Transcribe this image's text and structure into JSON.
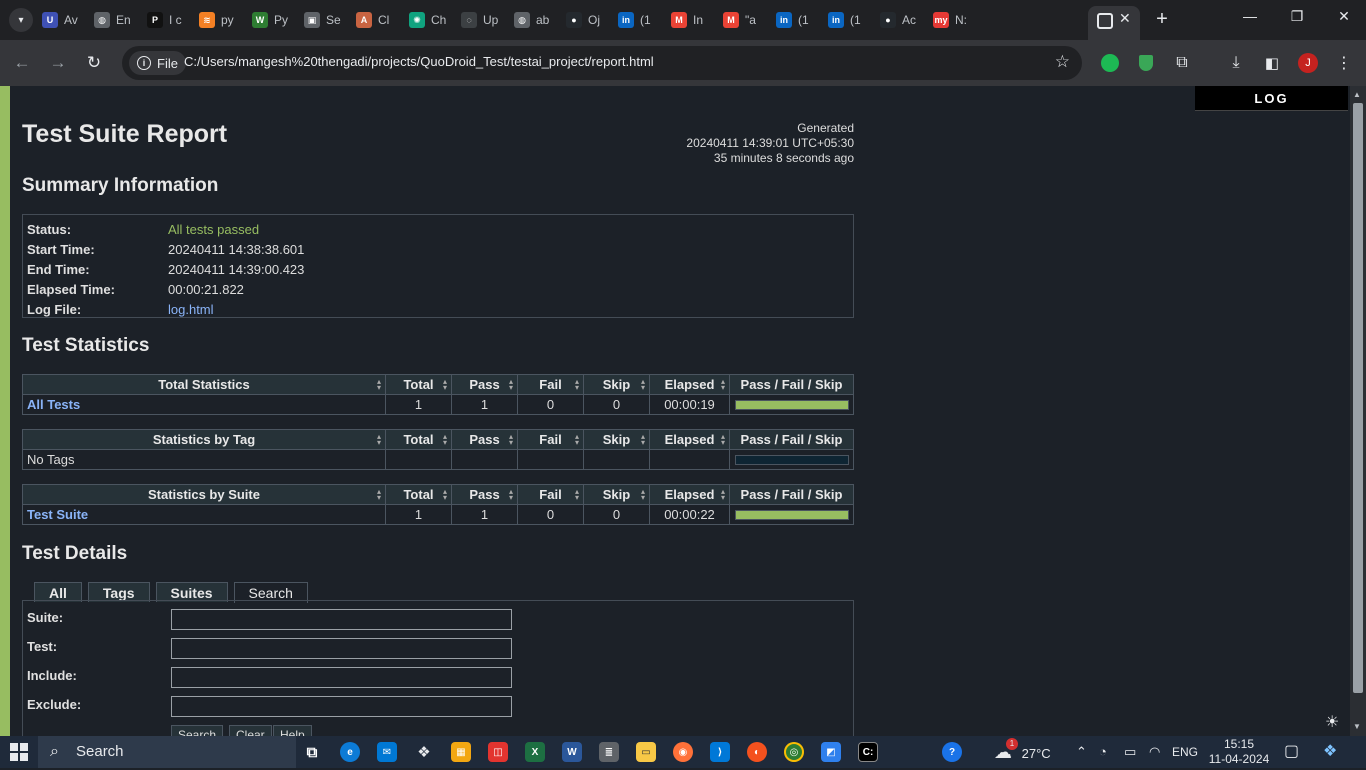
{
  "browser": {
    "tabs": [
      {
        "label": "Av",
        "icon": "u-icon",
        "color": "#3f51b5",
        "glyph": "U"
      },
      {
        "label": "En",
        "icon": "globe-icon",
        "color": "#5f6368",
        "glyph": "◍"
      },
      {
        "label": "I c",
        "icon": "p-icon",
        "color": "#111111",
        "glyph": "P"
      },
      {
        "label": "py",
        "icon": "stack-icon",
        "color": "#f48024",
        "glyph": "≋"
      },
      {
        "label": "Py",
        "icon": "w-icon",
        "color": "#2e7d32",
        "glyph": "W"
      },
      {
        "label": "Se",
        "icon": "report-icon",
        "color": "#5f6368",
        "glyph": "▣"
      },
      {
        "label": "Cl",
        "icon": "anthropic-icon",
        "color": "#c96442",
        "glyph": "A"
      },
      {
        "label": "Ch",
        "icon": "chatgpt-icon",
        "color": "#10a37f",
        "glyph": "✺"
      },
      {
        "label": "Up",
        "icon": "loading-icon",
        "color": "#3c4043",
        "glyph": "◌"
      },
      {
        "label": "ab",
        "icon": "globe-icon",
        "color": "#5f6368",
        "glyph": "◍"
      },
      {
        "label": "Oj",
        "icon": "github-icon",
        "color": "#24292e",
        "glyph": "●"
      },
      {
        "label": "(1",
        "icon": "linkedin-icon",
        "color": "#0a66c2",
        "glyph": "in"
      },
      {
        "label": "In",
        "icon": "gmail-icon",
        "color": "#ea4335",
        "glyph": "M"
      },
      {
        "label": "\"a",
        "icon": "gmail-icon",
        "color": "#ea4335",
        "glyph": "M"
      },
      {
        "label": "(1",
        "icon": "linkedin-icon",
        "color": "#0a66c2",
        "glyph": "in"
      },
      {
        "label": "(1",
        "icon": "linkedin-icon",
        "color": "#0a66c2",
        "glyph": "in"
      },
      {
        "label": "Ac",
        "icon": "github-icon",
        "color": "#24292e",
        "glyph": "●"
      },
      {
        "label": "N:",
        "icon": "my-icon",
        "color": "#e53935",
        "glyph": "my"
      }
    ],
    "chip_label": "File",
    "url": "C:/Users/mangesh%20thengadi/projects/QuoDroid_Test/testai_project/report.html",
    "profile_initial": "J"
  },
  "log_button": "LOG",
  "report": {
    "title": "Test Suite Report",
    "generated_label": "Generated",
    "generated_time": "20240411 14:39:01 UTC+05:30",
    "generated_ago": "35 minutes 8 seconds ago",
    "summary_title": "Summary Information",
    "summary": [
      {
        "key": "Status:",
        "value": "All tests passed"
      },
      {
        "key": "Start Time:",
        "value": "20240411 14:38:38.601"
      },
      {
        "key": "End Time:",
        "value": "20240411 14:39:00.423"
      },
      {
        "key": "Elapsed Time:",
        "value": "00:00:21.822"
      },
      {
        "key": "Log File:",
        "value": "log.html"
      }
    ],
    "statistics_title": "Test Statistics",
    "columns": [
      "Total",
      "Pass",
      "Fail",
      "Skip",
      "Elapsed",
      "Pass / Fail / Skip"
    ],
    "total_stats": {
      "header": "Total Statistics",
      "row": {
        "name": "All Tests",
        "total": "1",
        "pass": "1",
        "fail": "0",
        "skip": "0",
        "elapsed": "00:00:19",
        "pass_fraction": 1.0
      }
    },
    "tag_stats": {
      "header": "Statistics by Tag",
      "row": {
        "name": "No Tags",
        "total": "",
        "pass": "",
        "fail": "",
        "skip": "",
        "elapsed": "",
        "pass_fraction": 0.0
      }
    },
    "suite_stats": {
      "header": "Statistics by Suite",
      "row": {
        "name": "Test Suite",
        "total": "1",
        "pass": "1",
        "fail": "0",
        "skip": "0",
        "elapsed": "00:00:22",
        "pass_fraction": 1.0
      }
    },
    "details_title": "Test Details",
    "detail_tabs": [
      "All",
      "Tags",
      "Suites",
      "Search"
    ],
    "search_fields": [
      "Suite:",
      "Test:",
      "Include:",
      "Exclude:"
    ],
    "search_buttons": [
      "Search",
      "Clear",
      "Help"
    ]
  },
  "taskbar": {
    "search_placeholder": "Search",
    "weather": "27°C",
    "weather_badge": "1",
    "language": "ENG",
    "time": "15:15",
    "date": "11-04-2024"
  }
}
